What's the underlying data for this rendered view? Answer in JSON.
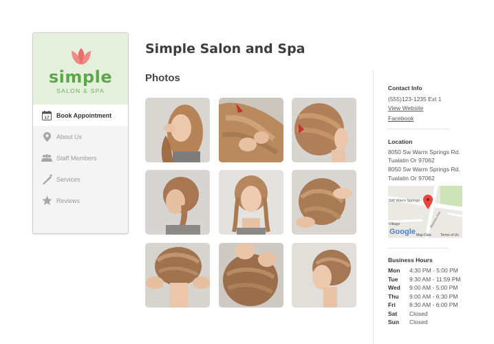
{
  "brand": {
    "word": "simple",
    "tagline": "SALON & SPA",
    "color": "#5aa84a",
    "accent": "#e96f6f"
  },
  "sidebar": {
    "items": [
      {
        "label": "Book Appointment",
        "icon": "calendar-icon",
        "calendar_day": "17",
        "active": true
      },
      {
        "label": "About Us",
        "icon": "location-pin-icon",
        "active": false
      },
      {
        "label": "Staff Members",
        "icon": "people-icon",
        "active": false
      },
      {
        "label": "Services",
        "icon": "comb-icon",
        "active": false
      },
      {
        "label": "Reviews",
        "icon": "star-icon",
        "active": false
      }
    ]
  },
  "main": {
    "title": "Simple Salon and Spa",
    "section_heading": "Photos",
    "photos": [
      {
        "icon": "hair-photo-icon"
      },
      {
        "icon": "hair-photo-icon"
      },
      {
        "icon": "hair-photo-icon"
      },
      {
        "icon": "hair-photo-icon"
      },
      {
        "icon": "hair-photo-icon"
      },
      {
        "icon": "hair-photo-icon"
      },
      {
        "icon": "hair-photo-icon"
      },
      {
        "icon": "hair-photo-icon"
      },
      {
        "icon": "hair-photo-icon"
      }
    ]
  },
  "contact": {
    "heading": "Contact Info",
    "phone": "(555)123-1235 Ext 1",
    "website_link": "View Website",
    "facebook_link": "Facebook"
  },
  "location": {
    "heading": "Location",
    "line1": "8050 Sw Warm Springs Rd.",
    "line2": "Tualatin Or 97062",
    "line3": "8050 Sw Warm Springs Rd.",
    "line4": "Tualatin Or 97062",
    "map": {
      "street_label": "SW Warm Springs",
      "village_label": "Village",
      "avenue_label": "Boones Ave",
      "google_label": "Google",
      "map_data_label": "Map Data",
      "terms_label": "Terms of Us",
      "marker_color": "#e8453c"
    }
  },
  "hours": {
    "heading": "Business Hours",
    "days": [
      {
        "day": "Mon",
        "time": "4:30 PM - 5:00 PM"
      },
      {
        "day": "Tue",
        "time": "9:30 AM - 11:59 PM"
      },
      {
        "day": "Wed",
        "time": "9:00 AM - 5:00 PM"
      },
      {
        "day": "Thu",
        "time": "9:00 AM - 6:30 PM"
      },
      {
        "day": "Fri",
        "time": "8:30 AM - 6:00 PM"
      },
      {
        "day": "Sat",
        "time": "Closed"
      },
      {
        "day": "Sun",
        "time": "Closed"
      }
    ]
  }
}
